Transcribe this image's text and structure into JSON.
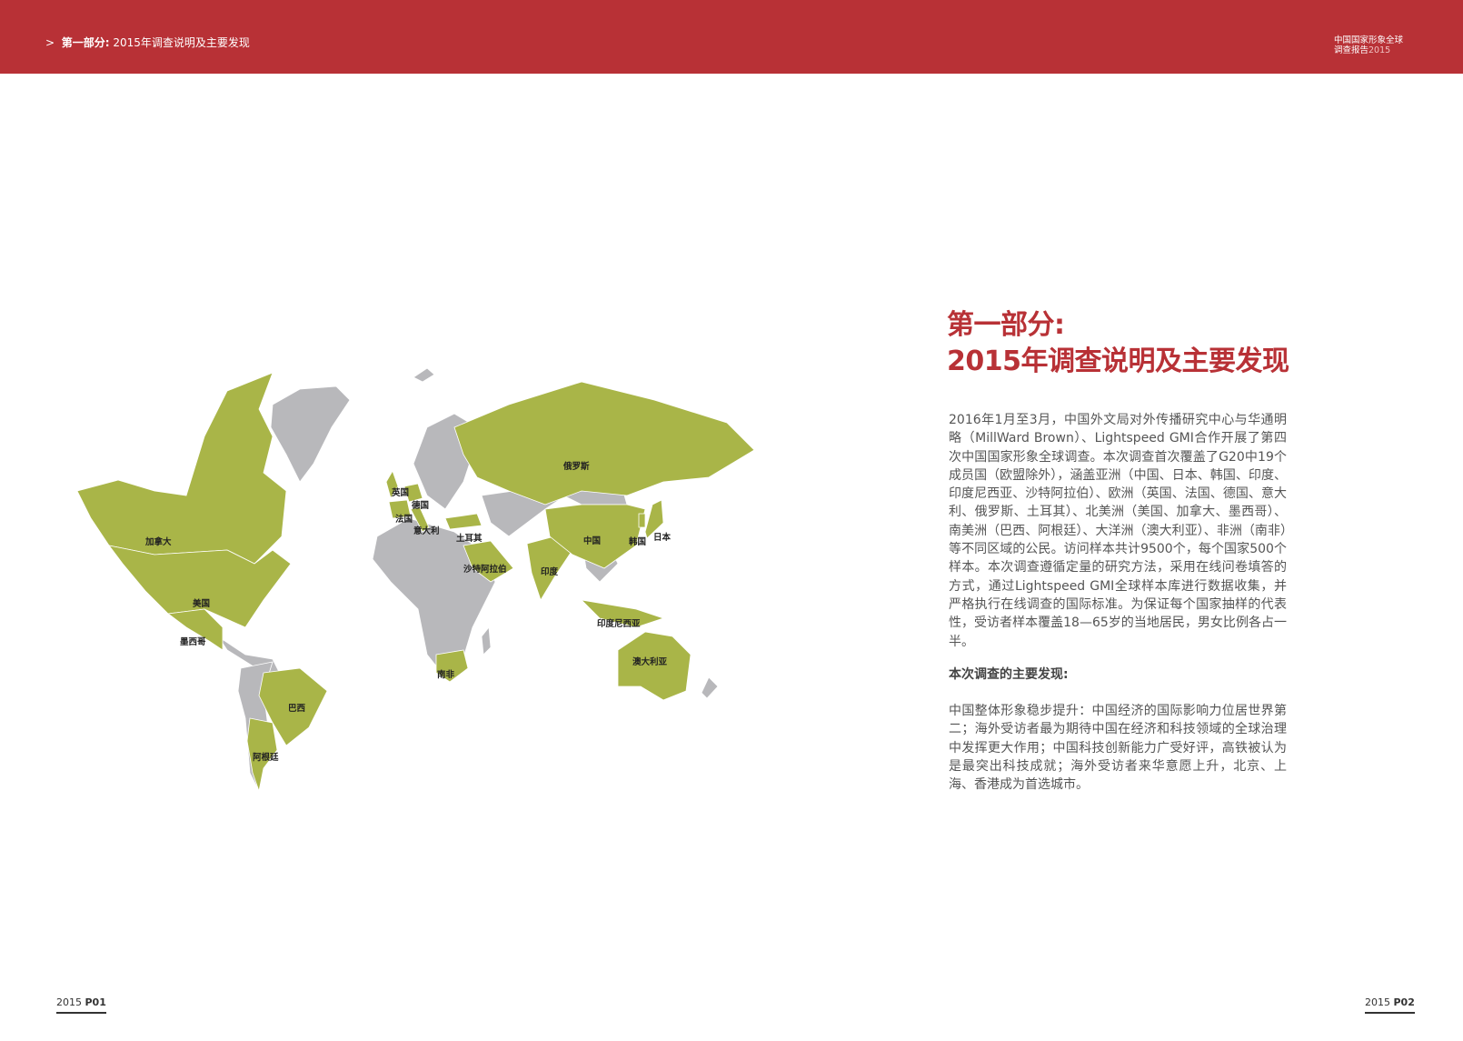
{
  "header": {
    "breadcrumb_arrow": ">",
    "breadcrumb_section": "第一部分:",
    "breadcrumb_title": "2015年调查说明及主要发现",
    "brand_line1": "中国国家形象全球",
    "brand_line2": "调查报告",
    "brand_year": "2015"
  },
  "title": {
    "line1": "第一部分:",
    "line2": "2015年调查说明及主要发现"
  },
  "body": "2016年1月至3月，中国外文局对外传播研究中心与华通明略（MillWard Brown）、Lightspeed GMI合作开展了第四次中国国家形象全球调查。本次调查首次覆盖了G20中19个成员国（欧盟除外），涵盖亚洲（中国、日本、韩国、印度、印度尼西亚、沙特阿拉伯）、欧洲（英国、法国、德国、意大利、俄罗斯、土耳其）、北美洲（美国、加拿大、墨西哥）、南美洲（巴西、阿根廷）、大洋洲（澳大利亚）、非洲（南非）等不同区域的公民。访问样本共计9500个，每个国家500个样本。本次调查遵循定量的研究方法，采用在线问卷填答的方式，通过Lightspeed GMI全球样本库进行数据收集，并严格执行在线调查的国际标准。为保证每个国家抽样的代表性，受访者样本覆盖18—65岁的当地居民，男女比例各占一半。",
  "findings_heading": "本次调查的主要发现:",
  "findings": "中国整体形象稳步提升：中国经济的国际影响力位居世界第二；海外受访者最为期待中国在经济和科技领域的全球治理中发挥更大作用；中国科技创新能力广受好评，高铁被认为是最突出科技成就；海外受访者来华意愿上升，北京、上海、香港成为首选城市。",
  "map": {
    "highlight_color": "#a9b548",
    "other_color": "#b8b8bb",
    "labels": {
      "canada": "加拿大",
      "usa": "美国",
      "mexico": "墨西哥",
      "brazil": "巴西",
      "argentina": "阿根廷",
      "uk": "英国",
      "germany": "德国",
      "france": "法国",
      "italy": "意大利",
      "turkey": "土耳其",
      "russia": "俄罗斯",
      "saudi": "沙特阿拉伯",
      "india": "印度",
      "china": "中国",
      "korea": "韩国",
      "japan": "日本",
      "indonesia": "印度尼西亚",
      "australia": "澳大利亚",
      "south_africa": "南非"
    }
  },
  "footer": {
    "left_year": "2015",
    "left_page": "P01",
    "right_year": "2015",
    "right_page": "P02"
  }
}
